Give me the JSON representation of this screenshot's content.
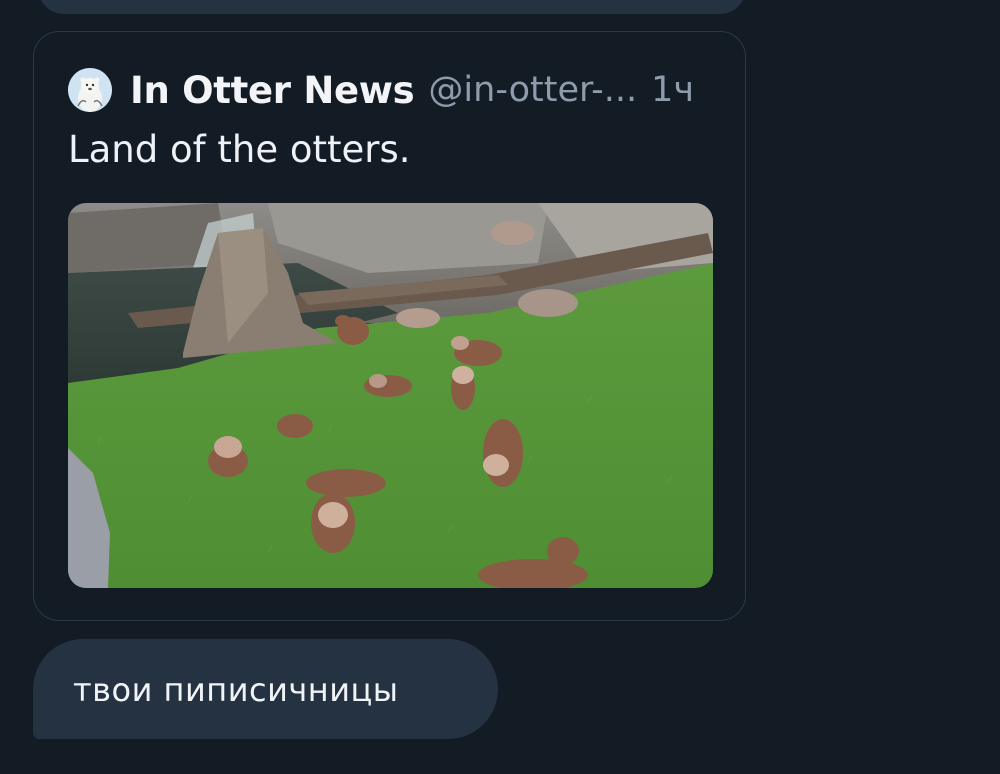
{
  "top_message": {},
  "post": {
    "author": "In Otter News",
    "handle": "@in-otter-...",
    "time": "1ч",
    "text": "Land of the otters.",
    "avatar_icon": "otter-avatar-icon",
    "image_icon": "otters-on-grass-photo"
  },
  "reply": {
    "text": "твои пиписичницы"
  },
  "colors": {
    "background": "#131b24",
    "bubble": "#243242",
    "card_border": "#2c3846",
    "muted_text": "#8e9bab",
    "primary_text": "#f2f4f7"
  }
}
